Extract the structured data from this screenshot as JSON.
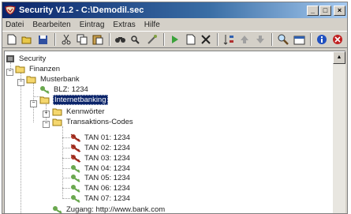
{
  "window": {
    "title": "Security V1.2 - C:\\Demodil.sec",
    "controls": {
      "minimize": "_",
      "maximize": "□",
      "close": "×"
    }
  },
  "menu": [
    {
      "label": "Datei"
    },
    {
      "label": "Bearbeiten"
    },
    {
      "label": "Eintrag"
    },
    {
      "label": "Extras"
    },
    {
      "label": "Hilfe"
    }
  ],
  "toolbar": {
    "icons": [
      "new-icon",
      "open-icon",
      "save-icon",
      "cut-icon",
      "copy-icon",
      "paste-icon",
      "find-icon",
      "find-next-icon",
      "tools-icon",
      "run-icon",
      "new-entry-icon",
      "delete-icon",
      "sort-icon",
      "up-icon",
      "down-icon",
      "search-icon",
      "properties-icon",
      "info-icon",
      "quit-icon"
    ]
  },
  "tree": {
    "root": {
      "label": "Security"
    },
    "finanzen": {
      "label": "Finanzen"
    },
    "musterbank": {
      "label": "Musterbank"
    },
    "blz": {
      "label": "BLZ: 1234"
    },
    "internetbanking": {
      "label": "Internetbanking"
    },
    "kennwoerter": {
      "label": "Kennwörter"
    },
    "tan_codes": {
      "label": "Transaktions-Codes"
    },
    "tans": [
      {
        "label": "TAN 01: 1234",
        "used": true
      },
      {
        "label": "TAN 02: 1234",
        "used": true
      },
      {
        "label": "TAN 03: 1234",
        "used": true
      },
      {
        "label": "TAN 04: 1234",
        "used": false
      },
      {
        "label": "TAN 05: 1234",
        "used": false
      },
      {
        "label": "TAN 06: 1234",
        "used": false
      },
      {
        "label": "TAN 07: 1234",
        "used": false
      }
    ],
    "zugang": {
      "label": "Zugang: http://www.bank.com"
    }
  },
  "colors": {
    "selection": "#0a246a",
    "folder": "#f5d76e",
    "key_used": "#b33a2a",
    "key_unused": "#6aa84f"
  }
}
